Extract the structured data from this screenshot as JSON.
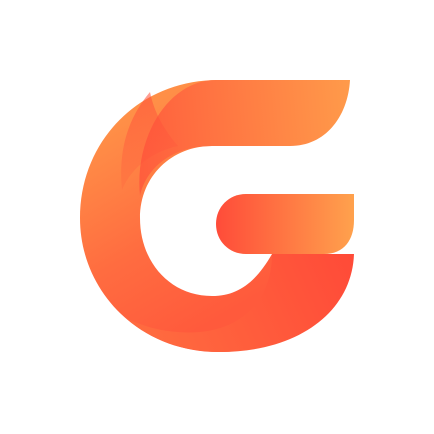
{
  "logo": {
    "icon": "letter-g-logo-icon",
    "colors": {
      "orange_light": "#FFA24D",
      "orange": "#FF7A42",
      "orange_red": "#FF5E3E",
      "red": "#FF4B39",
      "background": "#FFFFFF"
    }
  }
}
